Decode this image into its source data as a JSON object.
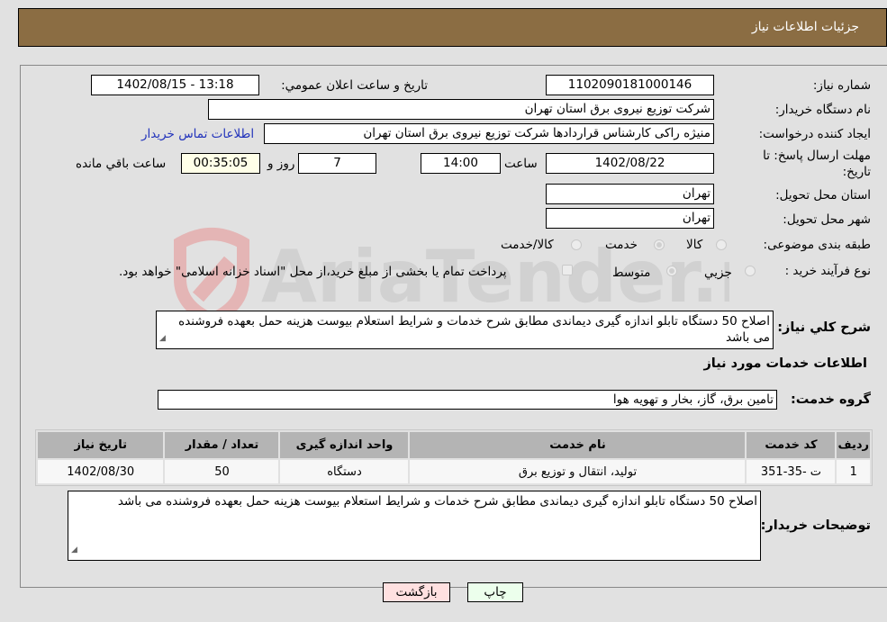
{
  "header": {
    "title": "جزئیات اطلاعات نیاز"
  },
  "form": {
    "need_number_label": "شماره نیاز:",
    "need_number": "1102090181000146",
    "announce_label": "تاریخ و ساعت اعلان عمومي:",
    "announce_value": "1402/08/15 - 13:18",
    "buyer_org_label": "نام دستگاه خريدار:",
    "buyer_org": "شرکت توزیع نیروی برق استان تهران",
    "creator_label": "ایجاد کننده درخواست:",
    "creator": "منیژه راکی کارشناس قراردادها شرکت توزیع نیروی برق استان تهران",
    "contact_link": "اطلاعات تماس خریدار",
    "deadline_label_line1": "مهلت ارسال پاسخ: تا",
    "deadline_label_line2": "تاریخ:",
    "deadline_date": "1402/08/22",
    "time_label": "ساعت",
    "deadline_time": "14:00",
    "days": "7",
    "days_label": "روز و",
    "remaining": "00:35:05",
    "remaining_label": "ساعت باقي مانده",
    "province_label": "استان محل تحویل:",
    "province": "تهران",
    "city_label": "شهر محل تحویل:",
    "city": "تهران",
    "category_label": "طبقه بندی موضوعی:",
    "category_options": [
      "کالا",
      "خدمت",
      "کالا/خدمت"
    ],
    "category_selected": "خدمت",
    "process_label": "نوع فرآیند خرید :",
    "process_options": [
      "جزيي",
      "متوسط"
    ],
    "process_selected": "متوسط",
    "treasury_note": "پرداخت تمام یا بخشی از مبلغ خرید،از محل \"اسناد خزانه اسلامی\" خواهد بود.",
    "summary_label": "شرح کلي نياز:",
    "summary": "اصلاح 50 دستگاه تابلو اندازه گیری دیماندی مطابق شرح خدمات و شرایط استعلام بیوست هزینه حمل بعهده فروشنده می باشد",
    "services_heading": "اطلاعات خدمات مورد نیاز",
    "service_group_label": "گروه خدمت:",
    "service_group": "تامین برق، گاز، بخار و تهویه هوا",
    "buyer_notes_label": "توضیحات خریدار:",
    "buyer_notes": "اصلاح 50 دستگاه تابلو اندازه گیری دیماندی مطابق شرح خدمات و شرایط استعلام بیوست هزینه حمل بعهده فروشنده می باشد"
  },
  "table": {
    "headers": [
      "ردیف",
      "کد خدمت",
      "نام خدمت",
      "واحد اندازه گیری",
      "تعداد / مقدار",
      "تاریخ نیاز"
    ],
    "rows": [
      [
        "1",
        "ت -35-351",
        "تولید، انتقال و توزیع برق",
        "دستگاه",
        "50",
        "1402/08/30"
      ]
    ]
  },
  "buttons": {
    "print": "چاپ",
    "back": "بازگشت"
  },
  "watermark": {
    "text": "AriaTender.neT"
  },
  "colors": {
    "header_bg": "#8b6d43",
    "back_btn": "#ffe0e0",
    "print_btn": "#ecffec",
    "link": "#2233bb"
  }
}
